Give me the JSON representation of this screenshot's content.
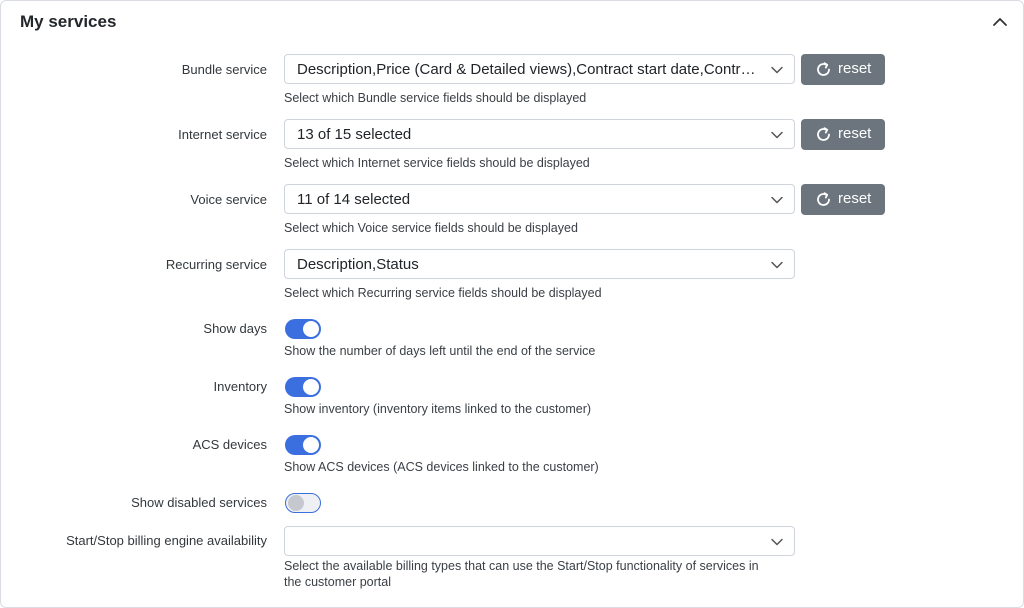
{
  "panel": {
    "title": "My services",
    "collapse_icon": "chevron-up-icon"
  },
  "fields": {
    "bundle": {
      "label": "Bundle service",
      "value": "Description,Price (Card & Detailed views),Contract start date,Contract end date",
      "help": "Select which Bundle service fields should be displayed",
      "reset_label": "reset"
    },
    "internet": {
      "label": "Internet service",
      "value": "13 of 15 selected",
      "help": "Select which Internet service fields should be displayed",
      "reset_label": "reset"
    },
    "voice": {
      "label": "Voice service",
      "value": "11 of 14 selected",
      "help": "Select which Voice service fields should be displayed",
      "reset_label": "reset"
    },
    "recurring": {
      "label": "Recurring service",
      "value": "Description,Status",
      "help": "Select which Recurring service fields should be displayed"
    },
    "show_days": {
      "label": "Show days",
      "enabled": true,
      "help": "Show the number of days left until the end of the service"
    },
    "inventory": {
      "label": "Inventory",
      "enabled": true,
      "help": "Show inventory (inventory items linked to the customer)"
    },
    "acs_devices": {
      "label": "ACS devices",
      "enabled": true,
      "help": "Show ACS devices (ACS devices linked to the customer)"
    },
    "show_disabled": {
      "label": "Show disabled services",
      "enabled": false
    },
    "start_stop": {
      "label": "Start/Stop billing engine availability",
      "value": "",
      "help_line1": "Select the available billing types that can use the Start/Stop functionality of services in",
      "help_line2": "the customer portal"
    }
  },
  "colors": {
    "toggle_on": "#3b6fe0",
    "reset_button": "#6c757d"
  }
}
